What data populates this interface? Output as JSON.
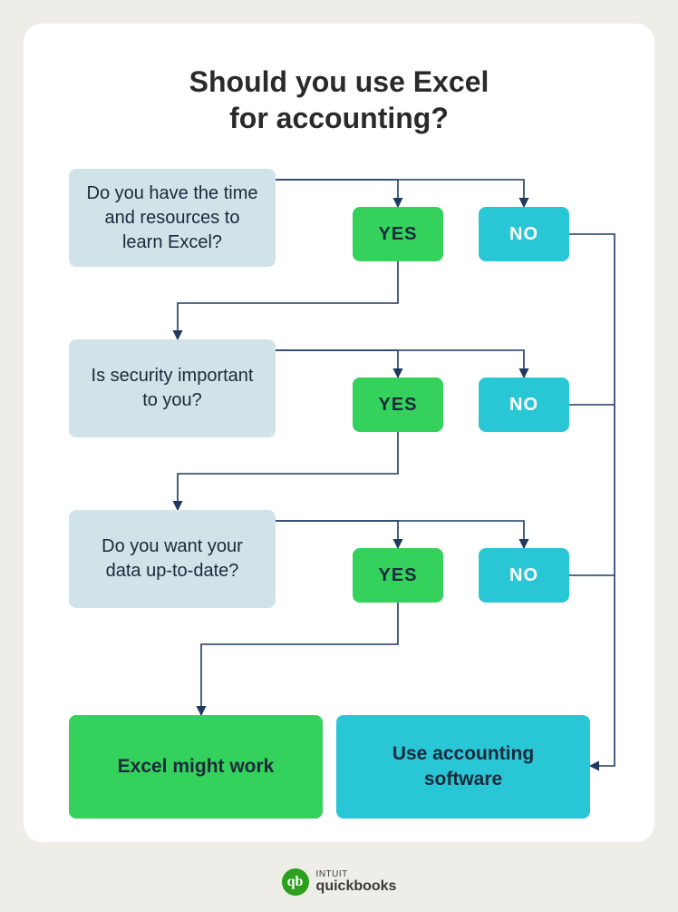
{
  "title_line1": "Should you use Excel",
  "title_line2": "for accounting?",
  "q1": "Do you have the time and resources to learn Excel?",
  "q2": "Is security important to you?",
  "q3": "Do you want your data up-to-date?",
  "yes": "YES",
  "no": "NO",
  "outcome_yes": "Excel might work",
  "outcome_no": "Use accounting software",
  "brand_top": "INTUIT",
  "brand_bottom": "quickbooks",
  "colors": {
    "page_bg": "#eeede7",
    "card_bg": "#ffffff",
    "question_bg": "#cfe3e9",
    "yes_bg": "#34d15c",
    "no_bg": "#29c6d6",
    "connector": "#1e3a5f"
  },
  "chart_data": {
    "type": "flowchart",
    "title": "Should you use Excel for accounting?",
    "nodes": [
      {
        "id": "q1",
        "type": "question",
        "text": "Do you have the time and resources to learn Excel?"
      },
      {
        "id": "q1_yes",
        "type": "option",
        "text": "YES"
      },
      {
        "id": "q1_no",
        "type": "option",
        "text": "NO"
      },
      {
        "id": "q2",
        "type": "question",
        "text": "Is security important to you?"
      },
      {
        "id": "q2_yes",
        "type": "option",
        "text": "YES"
      },
      {
        "id": "q2_no",
        "type": "option",
        "text": "NO"
      },
      {
        "id": "q3",
        "type": "question",
        "text": "Do you want your data up-to-date?"
      },
      {
        "id": "q3_yes",
        "type": "option",
        "text": "YES"
      },
      {
        "id": "q3_no",
        "type": "option",
        "text": "NO"
      },
      {
        "id": "out_excel",
        "type": "outcome",
        "text": "Excel might work"
      },
      {
        "id": "out_software",
        "type": "outcome",
        "text": "Use accounting software"
      }
    ],
    "edges": [
      {
        "from": "q1",
        "to": "q1_yes"
      },
      {
        "from": "q1",
        "to": "q1_no"
      },
      {
        "from": "q1_yes",
        "to": "q2"
      },
      {
        "from": "q1_no",
        "to": "out_software"
      },
      {
        "from": "q2",
        "to": "q2_yes"
      },
      {
        "from": "q2",
        "to": "q2_no"
      },
      {
        "from": "q2_yes",
        "to": "q3"
      },
      {
        "from": "q2_no",
        "to": "out_software"
      },
      {
        "from": "q3",
        "to": "q3_yes"
      },
      {
        "from": "q3",
        "to": "q3_no"
      },
      {
        "from": "q3_yes",
        "to": "out_excel"
      },
      {
        "from": "q3_no",
        "to": "out_software"
      }
    ]
  }
}
